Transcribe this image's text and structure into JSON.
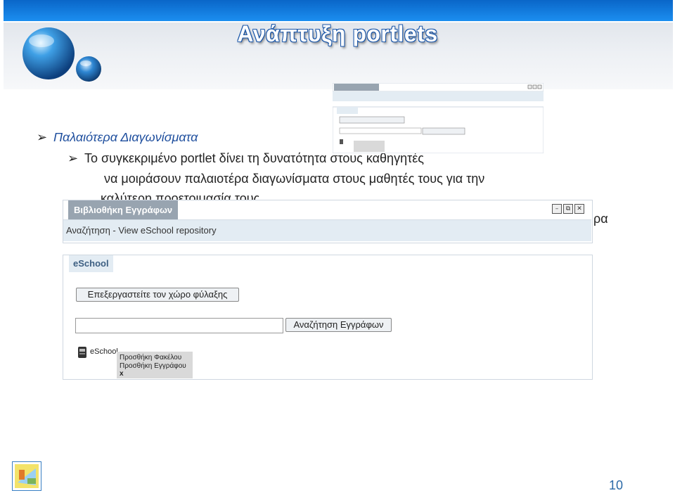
{
  "slide": {
    "title": "Ανάπτυξη portlets",
    "bullet1": "Παλαιότερα Διαγωνίσματα",
    "bullet2": "Το συγκεκριμένο portlet δίνει τη δυνατότητα στους καθηγητές",
    "line2": "να μοιράσουν παλαιοτέρα διαγωνίσματα στους μαθητές τους για την",
    "line3": "καλύτερη προετοιμασία τους.",
    "line_end": "ρα",
    "page_number": "10",
    "arrow_glyph": "➢"
  },
  "portlet": {
    "title": "Βιβλιοθήκη Εγγράφων",
    "subtitle": "Αναζήτηση - View eSchool repository",
    "section": "eSchool",
    "work_button": "Επεξεργαστείτε τον χώρο φύλαξης",
    "search_value": "",
    "search_button": "Αναζήτηση Εγγράφων",
    "tree_label": "eSchool",
    "menu_add_folder": "Προσθήκη Φακέλου",
    "menu_add_document": "Προσθήκη Εγγράφου",
    "menu_close": "x",
    "minimize_glyph": "–",
    "maximize_glyph": "⧉",
    "close_glyph": "✕"
  },
  "colors": {
    "accent": "#1a56a8",
    "bullet_italic": "#1f4f9e",
    "portlet_title_bg": "#98a4b0",
    "portlet_bar_bg": "#e3ecf3"
  }
}
